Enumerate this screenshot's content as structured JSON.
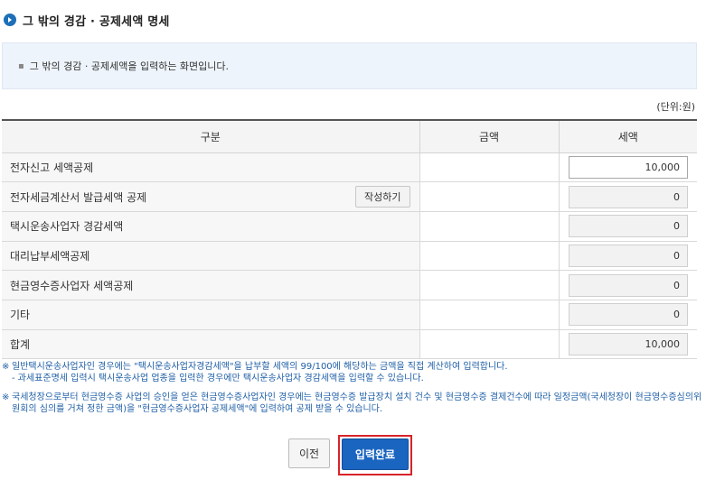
{
  "page": {
    "title": "그 밖의 경감 · 공제세액 명세",
    "info": "그 밖의 경감 · 공제세액을 입력하는 화면입니다.",
    "unit": "(단위:원)"
  },
  "table": {
    "headers": {
      "category": "구분",
      "amount": "금액",
      "tax": "세액"
    },
    "rows": [
      {
        "label": "전자신고 세액공제",
        "amount": "",
        "tax": "10,000",
        "editable": true
      },
      {
        "label": "전자세금계산서 발급세액 공제",
        "amount": "",
        "tax": "0",
        "button": "작성하기"
      },
      {
        "label": "택시운송사업자 경감세액",
        "amount": "",
        "tax": "0"
      },
      {
        "label": "대리납부세액공제",
        "amount": "",
        "tax": "0"
      },
      {
        "label": "현금영수증사업자 세액공제",
        "amount": "",
        "tax": "0"
      },
      {
        "label": "기타",
        "amount": "",
        "tax": "0"
      },
      {
        "label": "합계",
        "amount": "",
        "tax": "10,000"
      }
    ]
  },
  "notes": {
    "mark": "※",
    "note1": "일반택시운송사업자인 경우에는 \"택시운송사업자경감세액\"을 납부할 세액의 99/100에 해당하는 금액을 직접 계산하여 입력합니다.",
    "note1_sub": "- 과세표준명세 입력시 택시운송사업 업종을 입력한 경우에만 택시운송사업자 경감세액을 입력할 수 있습니다.",
    "note2": "국세청장으로부터 현금영수증 사업의 승인을 얻은 현금영수증사업자인 경우에는 현금영수증 발급장치 설치 건수 및 현금영수증 결제건수에 따라 일정금액(국세청장이 현금영수증심의위원회의 심의를 거쳐 정한 금액)을 \"현금영수증사업자 공제세액\"에 입력하여 공제 받을 수 있습니다."
  },
  "buttons": {
    "prev": "이전",
    "done": "입력완료"
  },
  "colors": {
    "accent": "#1a65c0",
    "highlight": "#d8232a",
    "note": "#1f5fa6"
  }
}
